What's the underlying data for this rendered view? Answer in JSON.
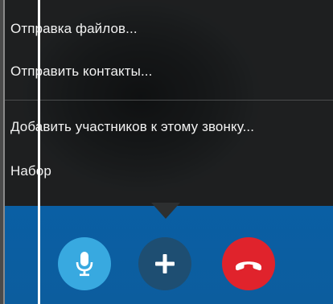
{
  "menu": {
    "items": [
      {
        "label": "Отправка файлов..."
      },
      {
        "label": "Отправить контакты..."
      },
      {
        "label": "Добавить участников к этому звонку..."
      },
      {
        "label": "Набор"
      }
    ]
  },
  "call_controls": {
    "microphone_icon": "microphone-icon",
    "add_icon": "plus-icon",
    "hangup_icon": "phone-hangup-icon"
  },
  "colors": {
    "call_bar": "#0c5d9e",
    "mic_button": "#38a9e0",
    "add_button": "#1e4e72",
    "hangup_button": "#e0232c"
  }
}
